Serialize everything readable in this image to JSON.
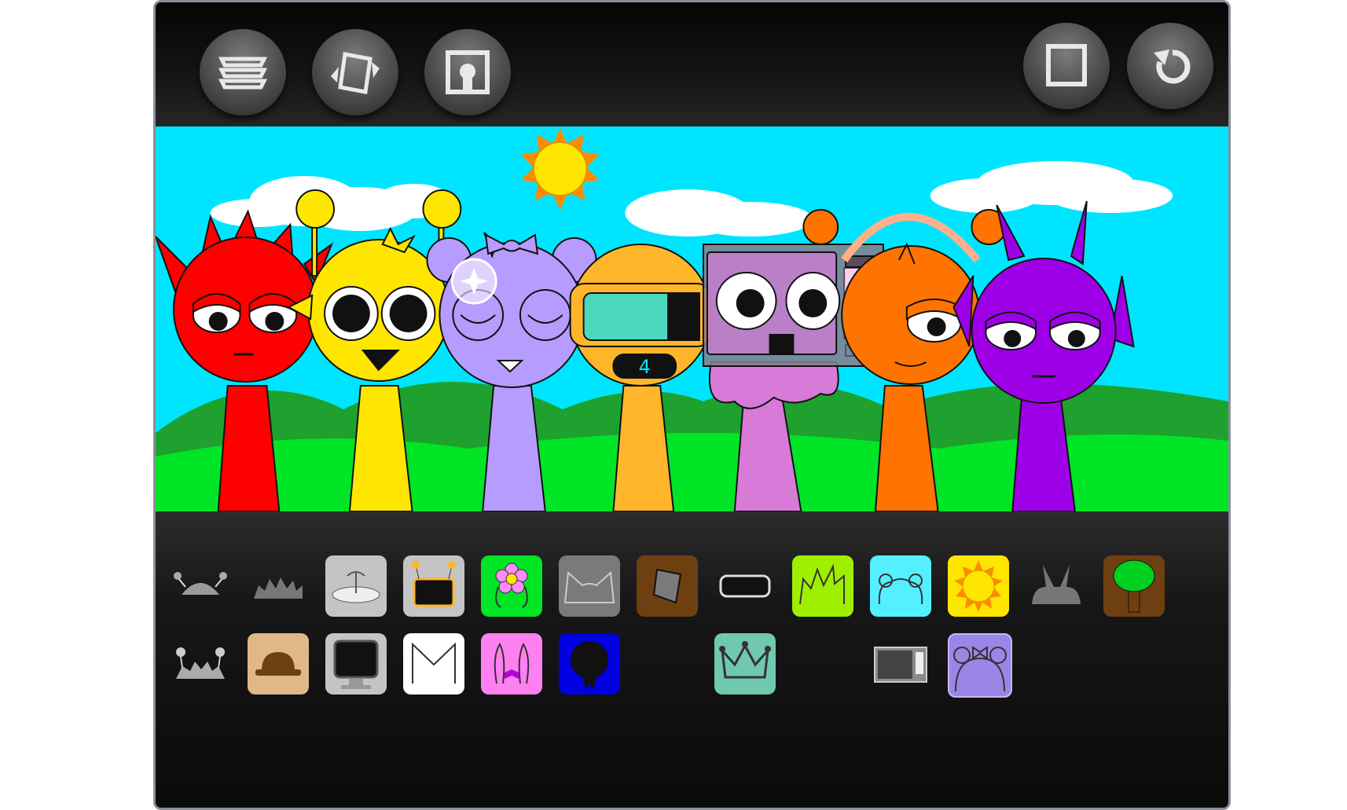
{
  "toolbar": {
    "left_buttons": [
      "menu-icon",
      "shuffle-cards-icon",
      "portrait-icon"
    ],
    "right_buttons": [
      "stop-square-icon",
      "reset-icon"
    ]
  },
  "stage": {
    "sky_color": "#00e5ff",
    "grass_color": "#00e526",
    "characters": [
      {
        "color": "#ff0000",
        "type": "red-spiky"
      },
      {
        "color": "#ffe600",
        "type": "yellow-antenna"
      },
      {
        "color": "#b69cff",
        "type": "purple-bear-bow"
      },
      {
        "color": "#ffb62b",
        "type": "orange-visor",
        "visor_number": "4"
      },
      {
        "color": "#d77ad8",
        "type": "pink-microwave-head"
      },
      {
        "color": "#ff7400",
        "type": "orange-headphones"
      },
      {
        "color": "#9d00e6",
        "type": "violet-horns"
      }
    ],
    "selected_character_index": 2
  },
  "palette": {
    "row1": [
      "antenna-head",
      "spiky-head",
      "propeller-hat",
      "tv-antenna",
      "flower",
      "cat-ears",
      "bucket-hat",
      "visor",
      "grass-hair",
      "bear-ears",
      "sun",
      "horns",
      "tree"
    ],
    "row2": [
      "antenna-hair",
      "bowler-hat",
      "computer-monitor",
      "cone-hat",
      "bunny-ears-bow",
      "medal",
      "empty",
      "crown",
      "empty",
      "microwave",
      "bear-bow"
    ],
    "selected_item": "bear-bow"
  },
  "colors": {
    "red": "#ff0000",
    "yellow": "#ffe600",
    "lavender": "#b69cff",
    "gold": "#ffb62b",
    "pink": "#d77ad8",
    "orange": "#ff7400",
    "violet": "#9d00e6"
  }
}
